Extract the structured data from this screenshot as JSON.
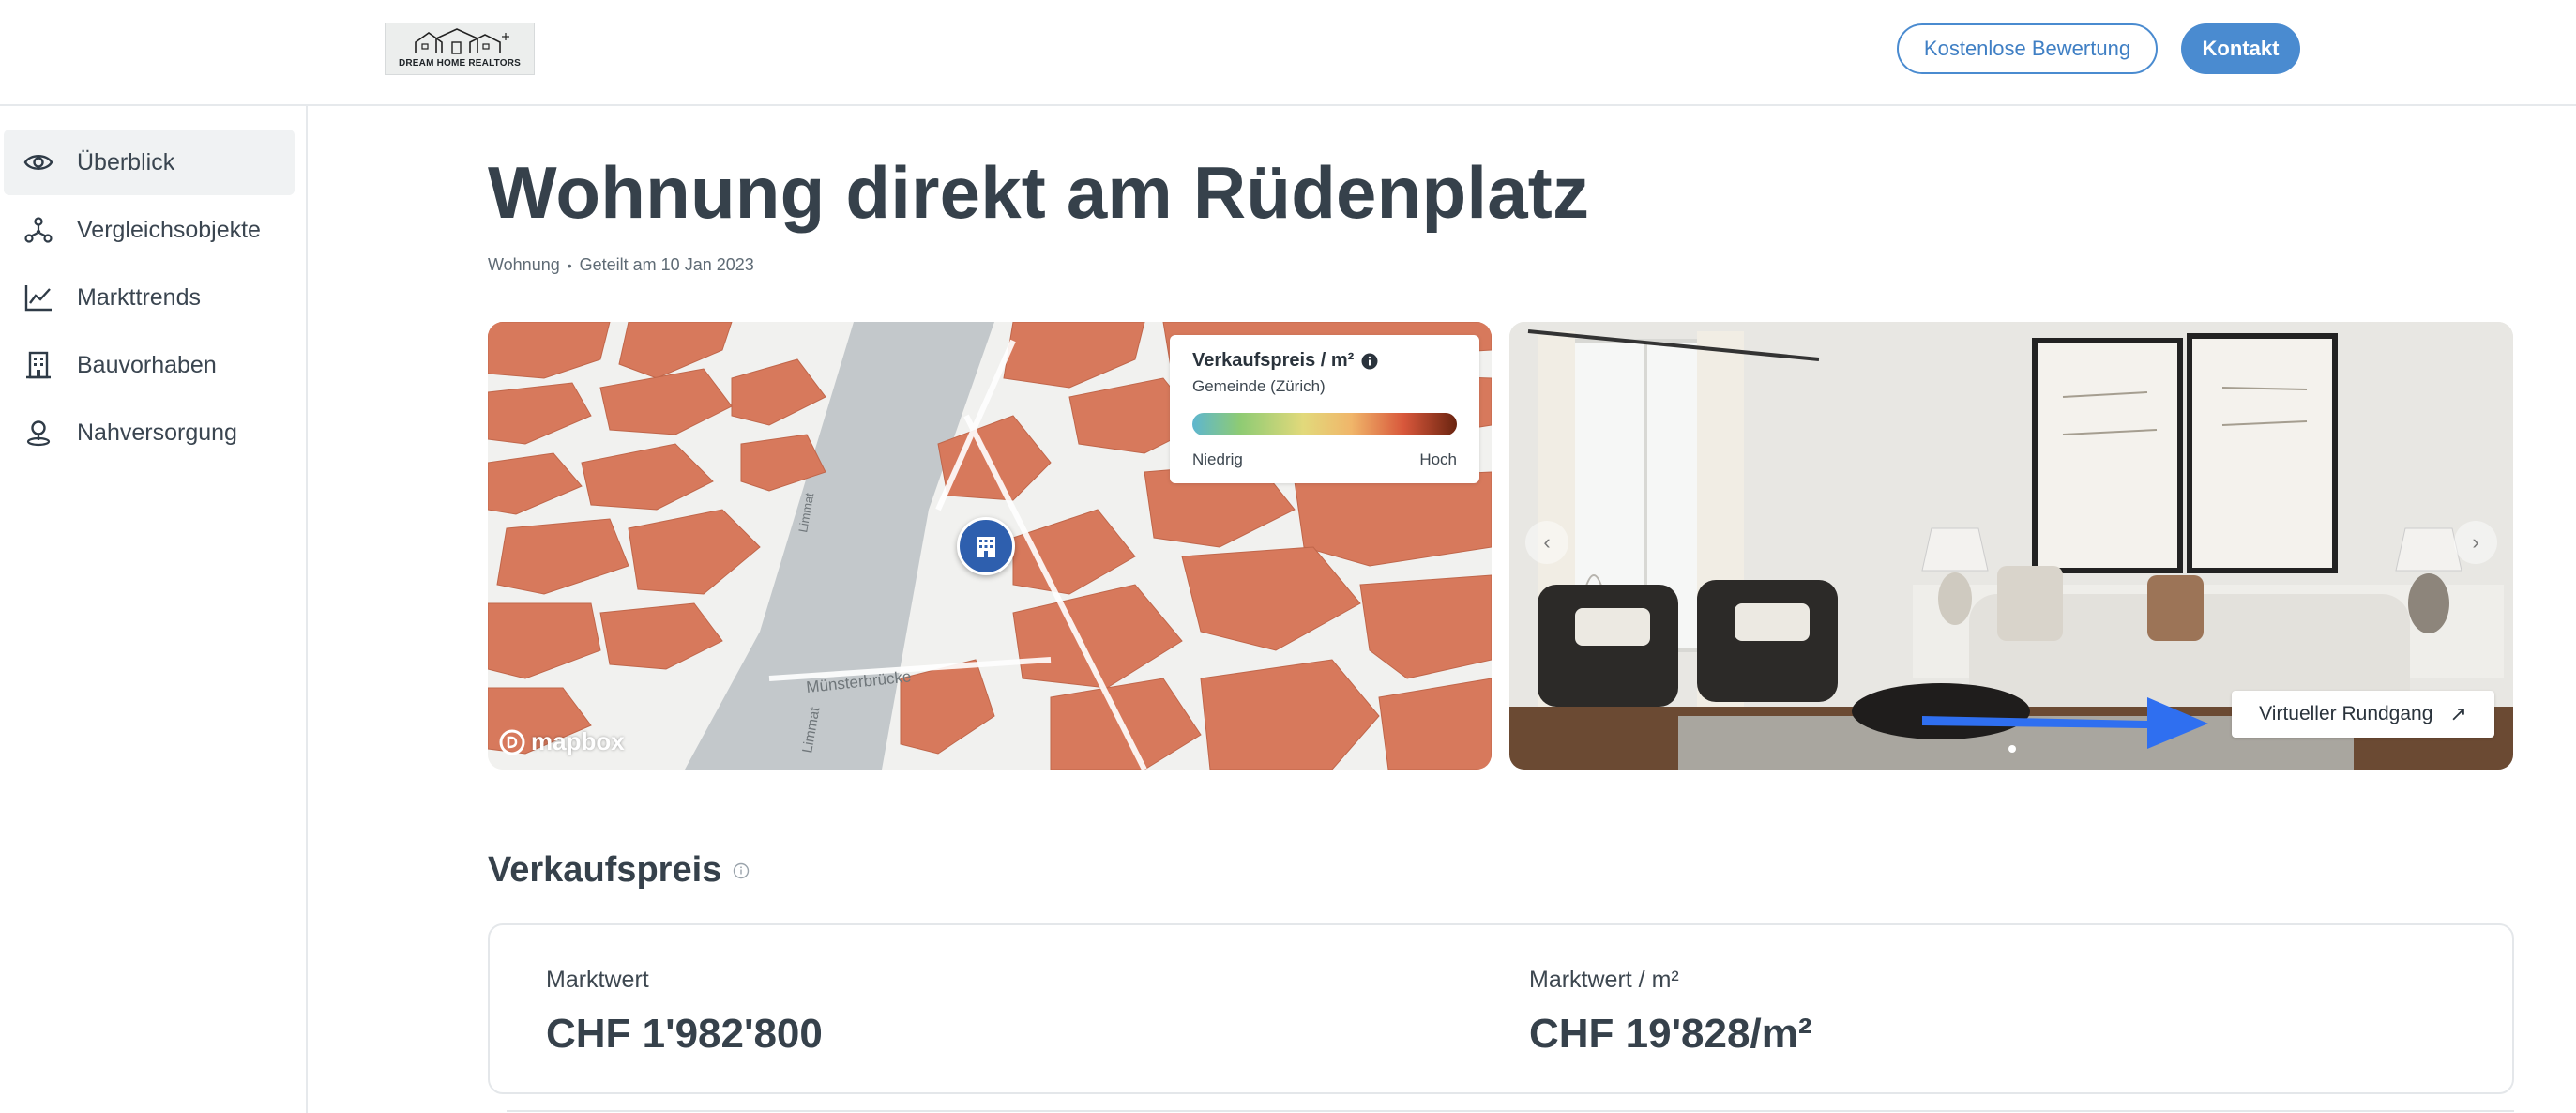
{
  "header": {
    "logo_text": "DREAM HOME REALTORS",
    "free_valuation_label": "Kostenlose Bewertung",
    "contact_label": "Kontakt",
    "accent_color": "#4a8bd0"
  },
  "sidebar": {
    "items": [
      {
        "label": "Überblick",
        "icon": "eye-icon",
        "active": true
      },
      {
        "label": "Vergleichsobjekte",
        "icon": "network-icon",
        "active": false
      },
      {
        "label": "Markttrends",
        "icon": "line-chart-icon",
        "active": false
      },
      {
        "label": "Bauvorhaben",
        "icon": "building-icon",
        "active": false
      },
      {
        "label": "Nahversorgung",
        "icon": "location-person-icon",
        "active": false
      }
    ]
  },
  "main": {
    "title": "Wohnung direkt am Rüdenplatz",
    "type": "Wohnung",
    "shared": "Geteilt am 10 Jan 2023"
  },
  "map": {
    "legend_title": "Verkaufspreis / m²",
    "legend_subtitle": "Gemeinde (Zürich)",
    "legend_low": "Niedrig",
    "legend_high": "Hoch",
    "attribution": "mapbox",
    "street_labels": [
      "Limmat",
      "Münsterbrücke",
      "Limmat"
    ]
  },
  "gallery": {
    "tour_label": "Virtueller Rundgang",
    "prev_icon": "chevron-left-icon",
    "next_icon": "chevron-right-icon"
  },
  "price": {
    "section_title": "Verkaufspreis",
    "market_value_label": "Marktwert",
    "market_value": "CHF 1'982'800",
    "market_value_sqm_label": "Marktwert / m²",
    "market_value_sqm": "CHF 19'828/m²"
  }
}
